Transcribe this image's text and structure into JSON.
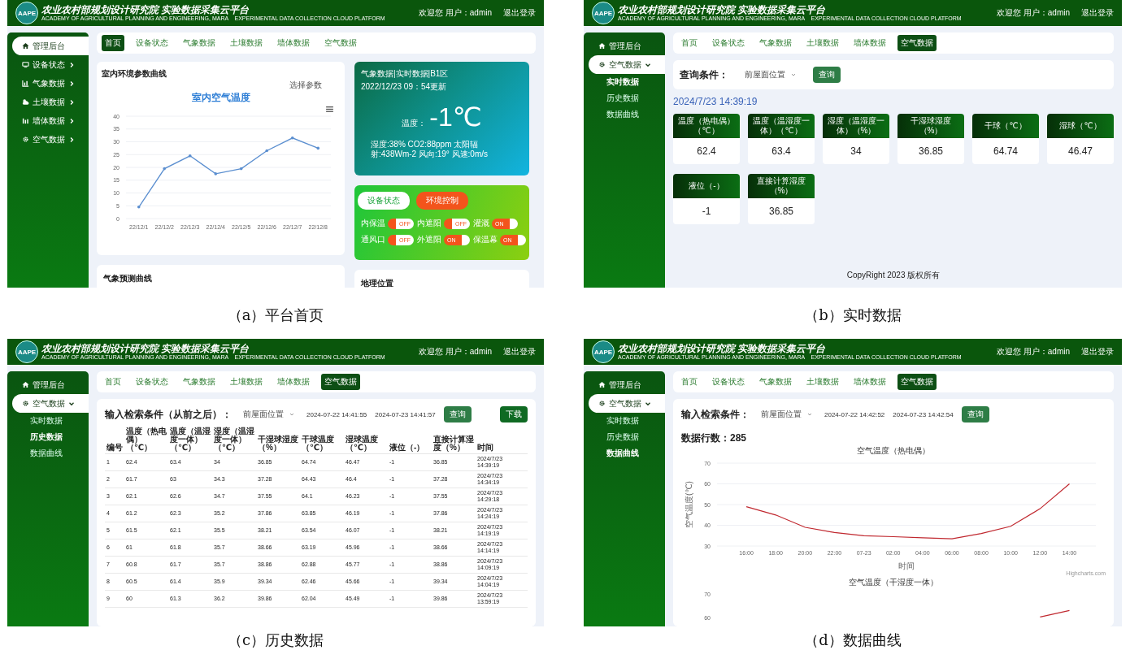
{
  "panels": [
    {
      "kind": "home",
      "caption": "（a）平台首页",
      "screen": {
        "header": {
          "logo": "AAPE",
          "title": "农业农村部规划设计研究院 实验数据采集云平台",
          "subtitle": "ACADEMY OF AGRICULTURAL PLANNING AND ENGINEERING, MARA    EXPERIMENTAL DATA COLLECTION CLOUD PLATFORM",
          "welcome": "欢迎您 用户：admin",
          "logout": "退出登录"
        },
        "sidebar": [
          {
            "label": "管理后台",
            "selected": true
          },
          {
            "label": "设备状态",
            "selected": false,
            "expanded": false
          },
          {
            "label": "气象数据",
            "selected": false,
            "expanded": false
          },
          {
            "label": "土壤数据",
            "selected": false,
            "expanded": false
          },
          {
            "label": "墙体数据",
            "selected": false,
            "expanded": false
          },
          {
            "label": "空气数据",
            "selected": false,
            "expanded": false
          }
        ],
        "tabs": [
          {
            "label": "首页",
            "selected": true
          },
          {
            "label": "设备状态",
            "selected": false
          },
          {
            "label": "气象数据",
            "selected": false
          },
          {
            "label": "土壤数据",
            "selected": false
          },
          {
            "label": "墙体数据",
            "selected": false
          },
          {
            "label": "空气数据",
            "selected": false
          }
        ],
        "chart_card": {
          "title": "室内环境参数曲线",
          "param_button": "选择参数",
          "chart_data": {
            "type": "line",
            "grid": true,
            "title": "室内空气温度",
            "categories": [
              "22/12/1",
              "22/12/2",
              "22/12/3",
              "22/12/4",
              "22/12/5",
              "22/12/6",
              "22/12/7",
              "22/12/8"
            ],
            "ylim": [
              0,
              40
            ],
            "yticks": [
              0,
              5,
              10,
              15,
              20,
              25,
              30,
              35,
              40
            ],
            "series": [
              {
                "color": "#5b8fd0",
                "values": [
                  4.5,
                  19.5,
                  24.5,
                  17.5,
                  19.5,
                  26.5,
                  31.5,
                  27.5
                ]
              }
            ]
          }
        },
        "weather": {
          "title": "气象数据|实时数据|B1区",
          "updated": "2022/12/23 09：54更新",
          "temp_label": "温度：",
          "temp_value": "-1℃",
          "details": "湿度:38% CO2:88ppm 太阳辐射:438Wm-2 风向:19° 风速:0m/s"
        },
        "control": {
          "buttons": [
            {
              "label": "设备状态",
              "selected": false
            },
            {
              "label": "环境控制",
              "selected": true
            }
          ],
          "switches": [
            {
              "label": "内保温",
              "on": false,
              "text": "OFF"
            },
            {
              "label": "内遮阳",
              "on": false,
              "text": "OFF"
            },
            {
              "label": "灌溉",
              "on": true,
              "text": "ON"
            },
            {
              "label": "通风口",
              "on": false,
              "text": "OFF"
            },
            {
              "label": "外遮阳",
              "on": true,
              "text": "ON"
            },
            {
              "label": "保温幕",
              "on": true,
              "text": "ON"
            }
          ]
        },
        "lower_cards": [
          {
            "title": "气象预测曲线"
          },
          {
            "title": "地理位置"
          }
        ]
      }
    },
    {
      "kind": "realtime",
      "caption": "（b）实时数据",
      "screen": {
        "header": {
          "logo": "AAPE",
          "title": "农业农村部规划设计研究院 实验数据采集云平台",
          "subtitle": "ACADEMY OF AGRICULTURAL PLANNING AND ENGINEERING, MARA    EXPERIMENTAL DATA COLLECTION CLOUD PLATFORM",
          "welcome": "欢迎您 用户：admin",
          "logout": "退出登录"
        },
        "sidebar": [
          {
            "label": "管理后台",
            "selected": false
          },
          {
            "label": "空气数据",
            "selected": true,
            "expanded": true,
            "children": [
              {
                "label": "实时数据",
                "selected": true
              },
              {
                "label": "历史数据",
                "selected": false
              },
              {
                "label": "数据曲线",
                "selected": false
              }
            ]
          }
        ],
        "tabs": [
          {
            "label": "首页",
            "selected": false
          },
          {
            "label": "设备状态",
            "selected": false
          },
          {
            "label": "气象数据",
            "selected": false
          },
          {
            "label": "土壤数据",
            "selected": false
          },
          {
            "label": "墙体数据",
            "selected": false
          },
          {
            "label": "空气数据",
            "selected": true
          }
        ],
        "query": {
          "label": "查询条件：",
          "select": "前屋面位置",
          "button": "查询"
        },
        "timestamp": "2024/7/23 14:39:19",
        "readings": [
          {
            "label": "温度（热电偶）（℃）",
            "value": "62.4"
          },
          {
            "label": "温度（温湿度一体）（℃）",
            "value": "63.4"
          },
          {
            "label": "湿度（温湿度一体）（%）",
            "value": "34"
          },
          {
            "label": "干湿球湿度（%）",
            "value": "36.85"
          },
          {
            "label": "干球（℃）",
            "value": "64.74"
          },
          {
            "label": "湿球（℃）",
            "value": "46.47"
          },
          {
            "label": "液位（-）",
            "value": "-1"
          },
          {
            "label": "直接计算湿度（%）",
            "value": "36.85"
          }
        ],
        "footer": "CopyRight 2023 版权所有"
      }
    },
    {
      "kind": "history",
      "caption": "（c）历史数据",
      "screen": {
        "header": {
          "logo": "AAPE",
          "title": "农业农村部规划设计研究院 实验数据采集云平台",
          "subtitle": "ACADEMY OF AGRICULTURAL PLANNING AND ENGINEERING, MARA    EXPERIMENTAL DATA COLLECTION CLOUD PLATFORM",
          "welcome": "欢迎您 用户：admin",
          "logout": "退出登录"
        },
        "sidebar": [
          {
            "label": "管理后台",
            "selected": false
          },
          {
            "label": "空气数据",
            "selected": true,
            "expanded": true,
            "children": [
              {
                "label": "实时数据",
                "selected": false
              },
              {
                "label": "历史数据",
                "selected": true
              },
              {
                "label": "数据曲线",
                "selected": false
              }
            ]
          }
        ],
        "tabs": [
          {
            "label": "首页",
            "selected": false
          },
          {
            "label": "设备状态",
            "selected": false
          },
          {
            "label": "气象数据",
            "selected": false
          },
          {
            "label": "土壤数据",
            "selected": false
          },
          {
            "label": "墙体数据",
            "selected": false
          },
          {
            "label": "空气数据",
            "selected": true
          }
        ],
        "query": {
          "label": "输入检索条件（从前之后）：",
          "select": "前屋面位置",
          "start": "2024-07-22 14:41:55",
          "end": "2024-07-23 14:41:57",
          "button": "查询",
          "download": "下载"
        },
        "table": {
          "columns": [
            "编号",
            "温度（热电偶）（℃）",
            "温度（温湿度一体）（℃）",
            "湿度（温湿度一体）（℃）",
            "干湿球湿度（%）",
            "干球温度（℃）",
            "湿球温度（℃）",
            "液位（-）",
            "直接计算湿度（%）",
            "时间"
          ],
          "rows": [
            [
              "1",
              "62.4",
              "63.4",
              "34",
              "36.85",
              "64.74",
              "46.47",
              "-1",
              "36.85",
              "2024/7/23 14:39:19"
            ],
            [
              "2",
              "61.7",
              "63",
              "34.3",
              "37.28",
              "64.43",
              "46.4",
              "-1",
              "37.28",
              "2024/7/23 14:34:19"
            ],
            [
              "3",
              "62.1",
              "62.6",
              "34.7",
              "37.55",
              "64.1",
              "46.23",
              "-1",
              "37.55",
              "2024/7/23 14:29:18"
            ],
            [
              "4",
              "61.2",
              "62.3",
              "35.2",
              "37.86",
              "63.85",
              "46.19",
              "-1",
              "37.86",
              "2024/7/23 14:24:19"
            ],
            [
              "5",
              "61.5",
              "62.1",
              "35.5",
              "38.21",
              "63.54",
              "46.07",
              "-1",
              "38.21",
              "2024/7/23 14:19:19"
            ],
            [
              "6",
              "61",
              "61.8",
              "35.7",
              "38.66",
              "63.19",
              "45.96",
              "-1",
              "38.66",
              "2024/7/23 14:14:19"
            ],
            [
              "7",
              "60.8",
              "61.7",
              "35.7",
              "38.86",
              "62.88",
              "45.77",
              "-1",
              "38.86",
              "2024/7/23 14:09:19"
            ],
            [
              "8",
              "60.5",
              "61.4",
              "35.9",
              "39.34",
              "62.46",
              "45.66",
              "-1",
              "39.34",
              "2024/7/23 14:04:19"
            ],
            [
              "9",
              "60",
              "61.3",
              "36.2",
              "39.86",
              "62.04",
              "45.49",
              "-1",
              "39.86",
              "2024/7/23 13:59:19"
            ]
          ]
        }
      }
    },
    {
      "kind": "curve",
      "caption": "（d）数据曲线",
      "screen": {
        "header": {
          "logo": "AAPE",
          "title": "农业农村部规划设计研究院 实验数据采集云平台",
          "subtitle": "ACADEMY OF AGRICULTURAL PLANNING AND ENGINEERING, MARA    EXPERIMENTAL DATA COLLECTION CLOUD PLATFORM",
          "welcome": "欢迎您 用户：admin",
          "logout": "退出登录"
        },
        "sidebar": [
          {
            "label": "管理后台",
            "selected": false
          },
          {
            "label": "空气数据",
            "selected": true,
            "expanded": true,
            "children": [
              {
                "label": "实时数据",
                "selected": false
              },
              {
                "label": "历史数据",
                "selected": false
              },
              {
                "label": "数据曲线",
                "selected": true
              }
            ]
          }
        ],
        "tabs": [
          {
            "label": "首页",
            "selected": false
          },
          {
            "label": "设备状态",
            "selected": false
          },
          {
            "label": "气象数据",
            "selected": false
          },
          {
            "label": "土壤数据",
            "selected": false
          },
          {
            "label": "墙体数据",
            "selected": false
          },
          {
            "label": "空气数据",
            "selected": true
          }
        ],
        "query": {
          "label": "输入检索条件：",
          "select": "前屋面位置",
          "start": "2024-07-22 14:42:52",
          "end": "2024-07-23 14:42:54",
          "button": "查询"
        },
        "row_count": "数据行数：285",
        "charts": [
          {
            "credit": "Highcharts.com",
            "chart_data": {
              "type": "line",
              "grid": true,
              "title": "空气温度（热电偶）",
              "xlabel": "时间",
              "ylabel": "空气温度(℃)",
              "ylim": [
                30,
                70
              ],
              "yticks": [
                30,
                40,
                50,
                60,
                70
              ],
              "categories": [
                "16:00",
                "18:00",
                "20:00",
                "22:00",
                "07-23",
                "02:00",
                "04:00",
                "06:00",
                "08:00",
                "10:00",
                "12:00",
                "14:00"
              ],
              "series": [
                {
                  "color": "#c0282f",
                  "values": [
                    49,
                    45,
                    39,
                    36.5,
                    35,
                    34.5,
                    34,
                    33.5,
                    36,
                    39.5,
                    48,
                    60
                  ]
                }
              ]
            }
          },
          {
            "chart_data": {
              "type": "line",
              "title": "空气温度（干湿度一体）",
              "ylim": [
                60,
                70
              ],
              "yticks": [
                60,
                70
              ],
              "categories": [
                null,
                null,
                null,
                null,
                null,
                null,
                null,
                null,
                null,
                null,
                null,
                null
              ],
              "series": [
                {
                  "color": "#c0282f",
                  "values": [
                    null,
                    null,
                    null,
                    null,
                    null,
                    null,
                    null,
                    null,
                    null,
                    null,
                    60.2,
                    63
                  ]
                }
              ]
            }
          }
        ]
      }
    }
  ]
}
